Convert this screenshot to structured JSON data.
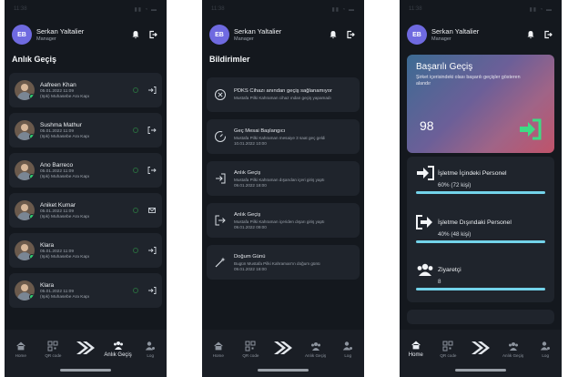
{
  "app": {
    "user": {
      "initials": "EB",
      "name": "Serkan Yaltalier",
      "role": "Manager"
    },
    "time": "11:38"
  },
  "screen1": {
    "title": "Anlık Geçiş",
    "persons": [
      {
        "name": "Aafreen Khan",
        "time": "05.01.2022 11:09",
        "place": "(Işık) Muhasebe Ara Kapı",
        "action_icon": "enter-icon"
      },
      {
        "name": "Sushma Mathur",
        "time": "05.01.2022 11:09",
        "place": "(Işık) Muhasebe Ara Kapı",
        "action_icon": "exit-icon"
      },
      {
        "name": "Ano Barreco",
        "time": "05.01.2022 11:09",
        "place": "(Işık) Muhasebe Ara Kapı",
        "action_icon": "exit-icon"
      },
      {
        "name": "Aniket Kumar",
        "time": "05.01.2022 11:09",
        "place": "(Işık) Muhasebe Ara Kapı",
        "action_icon": "mail-icon"
      },
      {
        "name": "Klara",
        "time": "05.01.2022 11:09",
        "place": "(Işık) Muhasebe Ara Kapı",
        "action_icon": "enter-icon"
      },
      {
        "name": "Klara",
        "time": "05.01.2022 11:09",
        "place": "(Işık) Muhasebe Ara Kapı",
        "action_icon": "enter-icon"
      }
    ]
  },
  "screen2": {
    "title": "Bildirimler",
    "notifications": [
      {
        "icon": "close-circle-icon",
        "title": "PDKS Cihazı anından geçiş sağlanamıyor",
        "message": "Mustafa Pilki Kahraman cihaz ından geçiş yapamadı",
        "date": ""
      },
      {
        "icon": "gauge-icon",
        "title": "Geç Mesai Başlangıcı",
        "message": "Mustafa Pilki Kahraman mesaiye 3 saat geç geldi",
        "date": "10.01.2022 10:00"
      },
      {
        "icon": "login-icon",
        "title": "Anlık Geçiş",
        "message": "Mustafa Pilki Kahraman dışarıdan içeri giriş yaptı",
        "date": "09.01.2022 18:00"
      },
      {
        "icon": "logout-icon",
        "title": "Anlık Geçiş",
        "message": "Mustafa Pilki Kahraman içeriden dışarı giriş yaptı",
        "date": "09.01.2022 09:00"
      },
      {
        "icon": "magic-wand-icon",
        "title": "Doğum Günü",
        "message": "Bugün Mustafa Pilki Kahraman'ın doğum günü",
        "date": "09.01.2022 18:00"
      }
    ]
  },
  "screen3": {
    "hero": {
      "title": "Başarılı Geçiş",
      "subtitle": "Şirket içerisindeki olası başarılı geçişler gösteren alandır",
      "value": "98"
    },
    "stats": [
      {
        "label": "İşletme İçindeki Personel",
        "value": "60% (72 kişi)",
        "percent": 60,
        "icon": "arrow-right-icon"
      },
      {
        "label": "İşletme Dışındaki Personel",
        "value": "40% (48 kişi)",
        "percent": 40,
        "icon": "exit-arrow-icon"
      },
      {
        "label": "Ziyaretçi",
        "value": "8",
        "percent": 8,
        "icon": "users-icon"
      }
    ]
  },
  "nav": {
    "home": "Home",
    "qr": "QR code",
    "center": "",
    "live": "Anlık Geçiş",
    "log": "Log"
  },
  "colors": {
    "accent": "#6f6ae0",
    "bar": "#73d3ea",
    "online": "#2ecc71",
    "card": "#1f242c",
    "bg": "#14181e"
  }
}
